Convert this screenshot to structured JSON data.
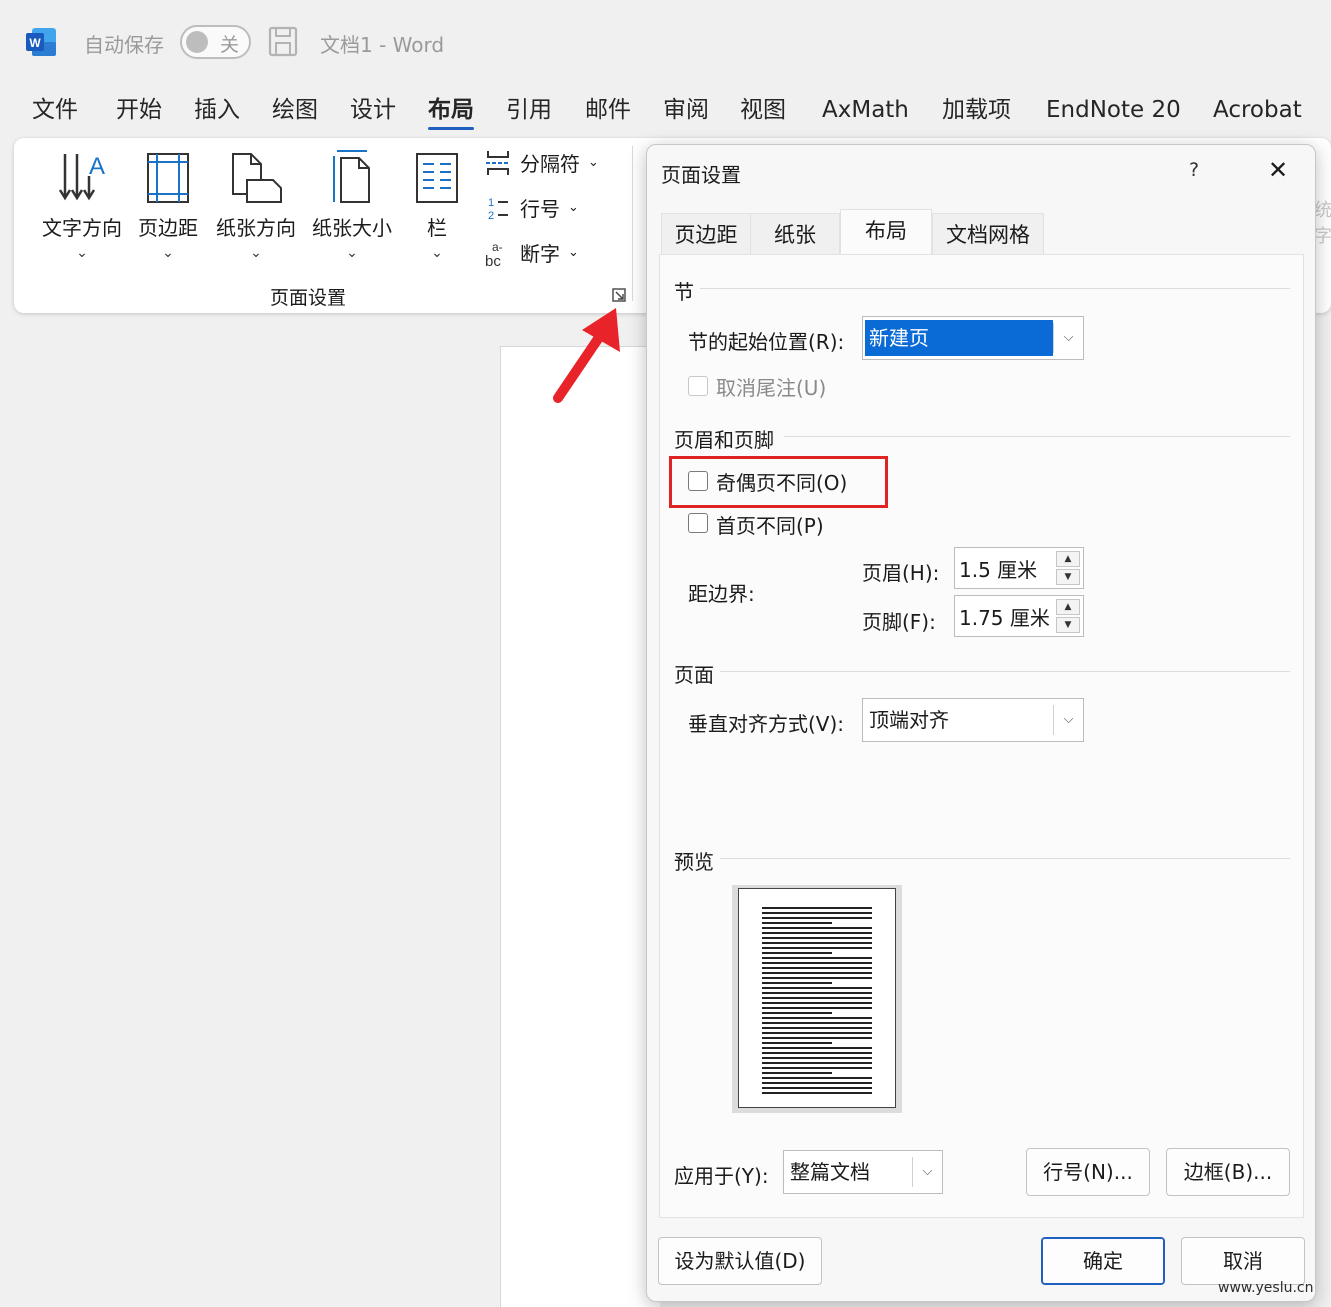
{
  "titlebar": {
    "autosave_label": "自动保存",
    "autosave_state": "关",
    "doc_title": "文档1  -  Word"
  },
  "menu": {
    "tabs": [
      "文件",
      "开始",
      "插入",
      "绘图",
      "设计",
      "布局",
      "引用",
      "邮件",
      "审阅",
      "视图",
      "AxMath",
      "加载项",
      "EndNote 20",
      "Acrobat"
    ],
    "active": "布局"
  },
  "ribbon": {
    "buttons": [
      "文字方向",
      "页边距",
      "纸张方向",
      "纸张大小",
      "栏"
    ],
    "small_buttons": [
      "分隔符",
      "行号",
      "断字"
    ],
    "group_label": "页面设置",
    "clipped_text": [
      "统",
      "字"
    ]
  },
  "dialog": {
    "title": "页面设置",
    "help": "?",
    "close": "✕",
    "tabs": [
      "页边距",
      "纸张",
      "布局",
      "文档网格"
    ],
    "active_tab": "布局",
    "section": {
      "title": "节",
      "start_label": "节的起始位置(R):",
      "start_value": "新建页",
      "suppress_endnotes": "取消尾注(U)"
    },
    "headers_footers": {
      "title": "页眉和页脚",
      "odd_even": "奇偶页不同(O)",
      "first_page": "首页不同(P)",
      "from_edge": "距边界:",
      "header_label": "页眉(H):",
      "header_value": "1.5 厘米",
      "footer_label": "页脚(F):",
      "footer_value": "1.75 厘米"
    },
    "page": {
      "title": "页面",
      "valign_label": "垂直对齐方式(V):",
      "valign_value": "顶端对齐"
    },
    "preview": {
      "title": "预览"
    },
    "apply_label": "应用于(Y):",
    "apply_value": "整篇文档",
    "line_numbers_btn": "行号(N)...",
    "borders_btn": "边框(B)...",
    "set_default_btn": "设为默认值(D)",
    "ok_btn": "确定",
    "cancel_btn": "取消"
  },
  "watermark": "www.yeslu.cn",
  "colors": {
    "accent": "#1f5fbf",
    "selection": "#0a6ad6",
    "highlight": "#e02424"
  }
}
